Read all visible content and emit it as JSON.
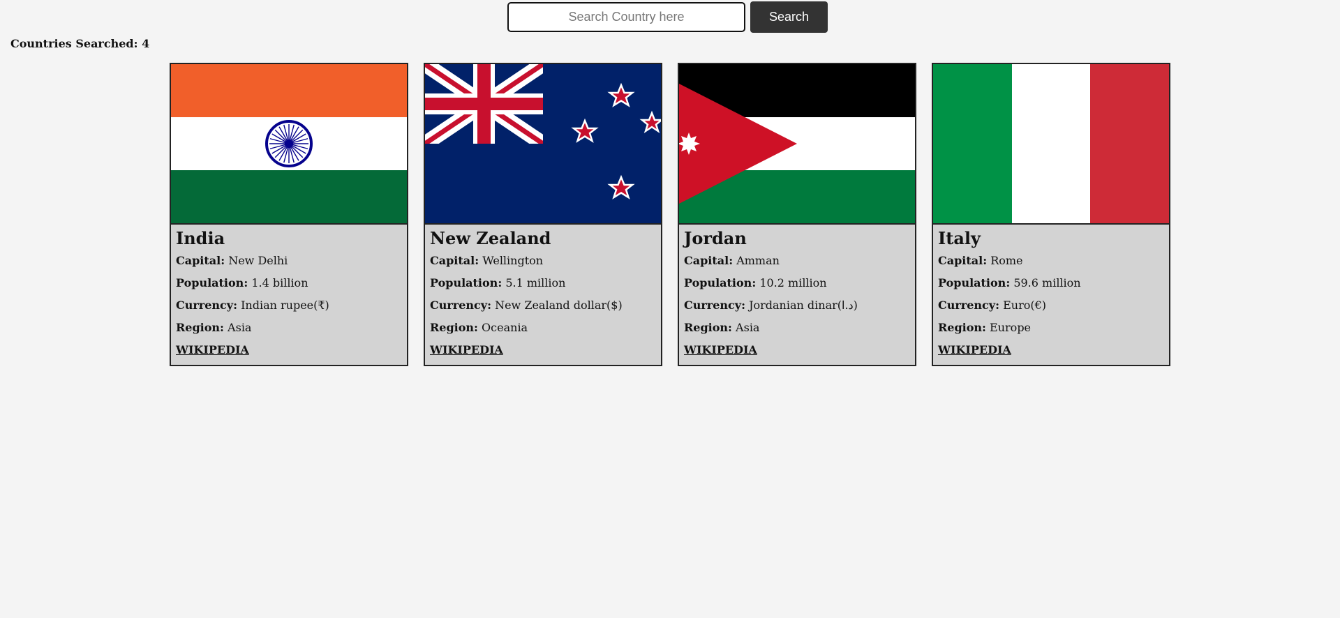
{
  "search": {
    "placeholder": "Search Country here",
    "button_label": "Search"
  },
  "counter": {
    "label": "Countries Searched: 4"
  },
  "labels": {
    "capital": "Capital:",
    "population": "Population:",
    "currency": "Currency:",
    "region": "Region:",
    "wiki": "WIKIPEDIA"
  },
  "countries": [
    {
      "name": "India",
      "capital": "New Delhi",
      "population": "1.4 billion",
      "currency": "Indian rupee(₹)",
      "region": "Asia",
      "flag_icon": "india-flag"
    },
    {
      "name": "New Zealand",
      "capital": "Wellington",
      "population": "5.1 million",
      "currency": "New Zealand dollar($)",
      "region": "Oceania",
      "flag_icon": "new-zealand-flag"
    },
    {
      "name": "Jordan",
      "capital": "Amman",
      "population": "10.2 million",
      "currency": "Jordanian dinar(د.ا)",
      "region": "Asia",
      "flag_icon": "jordan-flag"
    },
    {
      "name": "Italy",
      "capital": "Rome",
      "population": "59.6 million",
      "currency": "Euro(€)",
      "region": "Europe",
      "flag_icon": "italy-flag"
    }
  ],
  "colors": {
    "background": "#f4f4f4",
    "card_background": "#d3d3d3",
    "button_background": "#333333",
    "india_saffron": "#f15f2a",
    "india_green": "#046a38",
    "india_chakra": "#06038d",
    "nz_blue": "#012169",
    "nz_red": "#c8102e",
    "jordan_red": "#ce1126",
    "jordan_green": "#007a3d",
    "italy_green": "#009246",
    "italy_red": "#ce2b37"
  }
}
